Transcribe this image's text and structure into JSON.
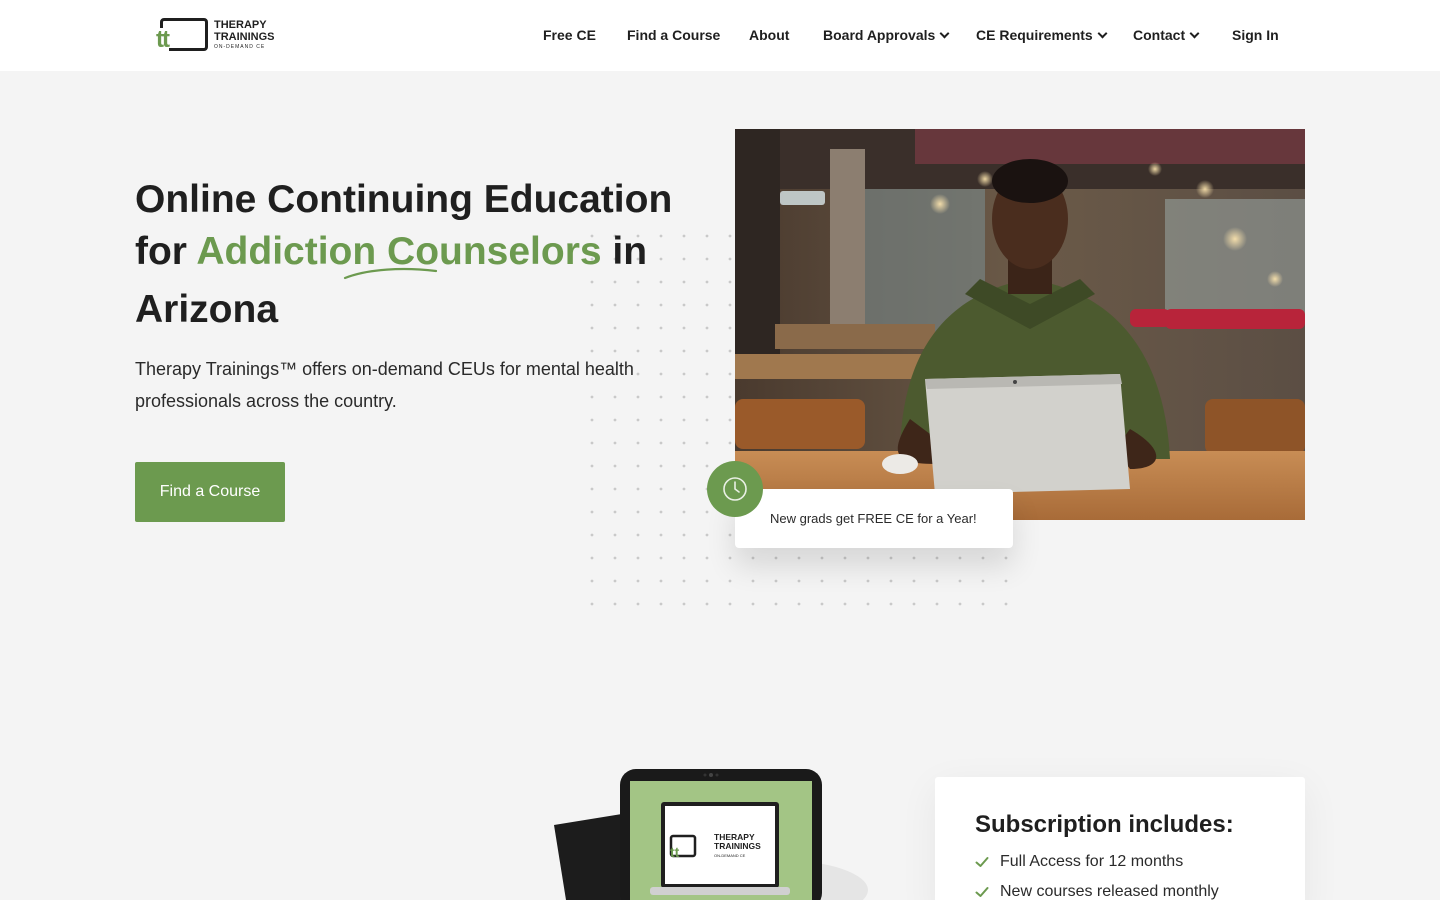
{
  "logo": {
    "mark": "tt",
    "line1": "THERAPY",
    "line2": "TRAININGS",
    "tagline": "ON-DEMAND CE",
    "brand_color": "#6c9a4f"
  },
  "nav": {
    "items": [
      {
        "label": "Free CE"
      },
      {
        "label": "Find a Course"
      },
      {
        "label": "About"
      },
      {
        "label": "Board Approvals",
        "icon": "chevron-down-icon"
      },
      {
        "label": "CE Requirements",
        "icon": "chevron-down-icon"
      },
      {
        "label": "Contact",
        "icon": "chevron-down-icon"
      },
      {
        "label": "Sign In"
      }
    ]
  },
  "hero": {
    "title_part1": "Online Continuing Education",
    "title_for": "for ",
    "title_highlight": "Addiction Counselors",
    "title_in": " in",
    "title_state": "Arizona",
    "description": "Therapy Trainings™ offers on-demand CEUs for mental health professionals across the country.",
    "cta_label": "Find a Course",
    "toast_text": "New grads get FREE CE for a Year!",
    "toast_icon": "clock-icon"
  },
  "subscription": {
    "title": "Subscription includes:",
    "items": [
      "Full Access for 12 months",
      "New courses released monthly"
    ],
    "check_icon": "check-icon"
  },
  "colors": {
    "accent": "#6c9a4f",
    "text": "#1f1f1f",
    "background": "#f4f4f4"
  }
}
